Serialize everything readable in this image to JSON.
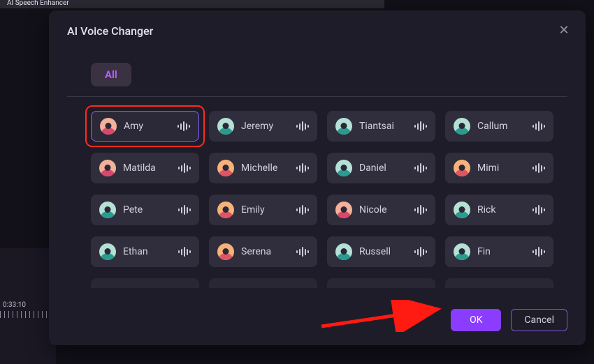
{
  "background": {
    "top_strip_label": "AI Speech Enhancer",
    "timeline_label": "0:33:10"
  },
  "dialog": {
    "title": "AI Voice Changer",
    "tabs": {
      "all": "All"
    },
    "buttons": {
      "ok": "OK",
      "cancel": "Cancel"
    }
  },
  "voices": [
    {
      "name": "Amy",
      "avatar": "pink",
      "selected": true,
      "highlighted": true
    },
    {
      "name": "Jeremy",
      "avatar": "teal",
      "selected": false,
      "highlighted": false
    },
    {
      "name": "Tiantsai",
      "avatar": "teal",
      "selected": false,
      "highlighted": false
    },
    {
      "name": "Callum",
      "avatar": "teal",
      "selected": false,
      "highlighted": false
    },
    {
      "name": "Matilda",
      "avatar": "pink",
      "selected": false,
      "highlighted": false
    },
    {
      "name": "Michelle",
      "avatar": "orange",
      "selected": false,
      "highlighted": false
    },
    {
      "name": "Daniel",
      "avatar": "teal",
      "selected": false,
      "highlighted": false
    },
    {
      "name": "Mimi",
      "avatar": "orange",
      "selected": false,
      "highlighted": false
    },
    {
      "name": "Pete",
      "avatar": "teal",
      "selected": false,
      "highlighted": false
    },
    {
      "name": "Emily",
      "avatar": "orange",
      "selected": false,
      "highlighted": false
    },
    {
      "name": "Nicole",
      "avatar": "pink",
      "selected": false,
      "highlighted": false
    },
    {
      "name": "Rick",
      "avatar": "teal",
      "selected": false,
      "highlighted": false
    },
    {
      "name": "Ethan",
      "avatar": "teal",
      "selected": false,
      "highlighted": false
    },
    {
      "name": "Serena",
      "avatar": "orange",
      "selected": false,
      "highlighted": false
    },
    {
      "name": "Russell",
      "avatar": "teal",
      "selected": false,
      "highlighted": false
    },
    {
      "name": "Fin",
      "avatar": "teal",
      "selected": false,
      "highlighted": false
    }
  ],
  "annotation": {
    "arrow_color": "#ff1a12",
    "highlight_color": "#ff2a1f"
  }
}
